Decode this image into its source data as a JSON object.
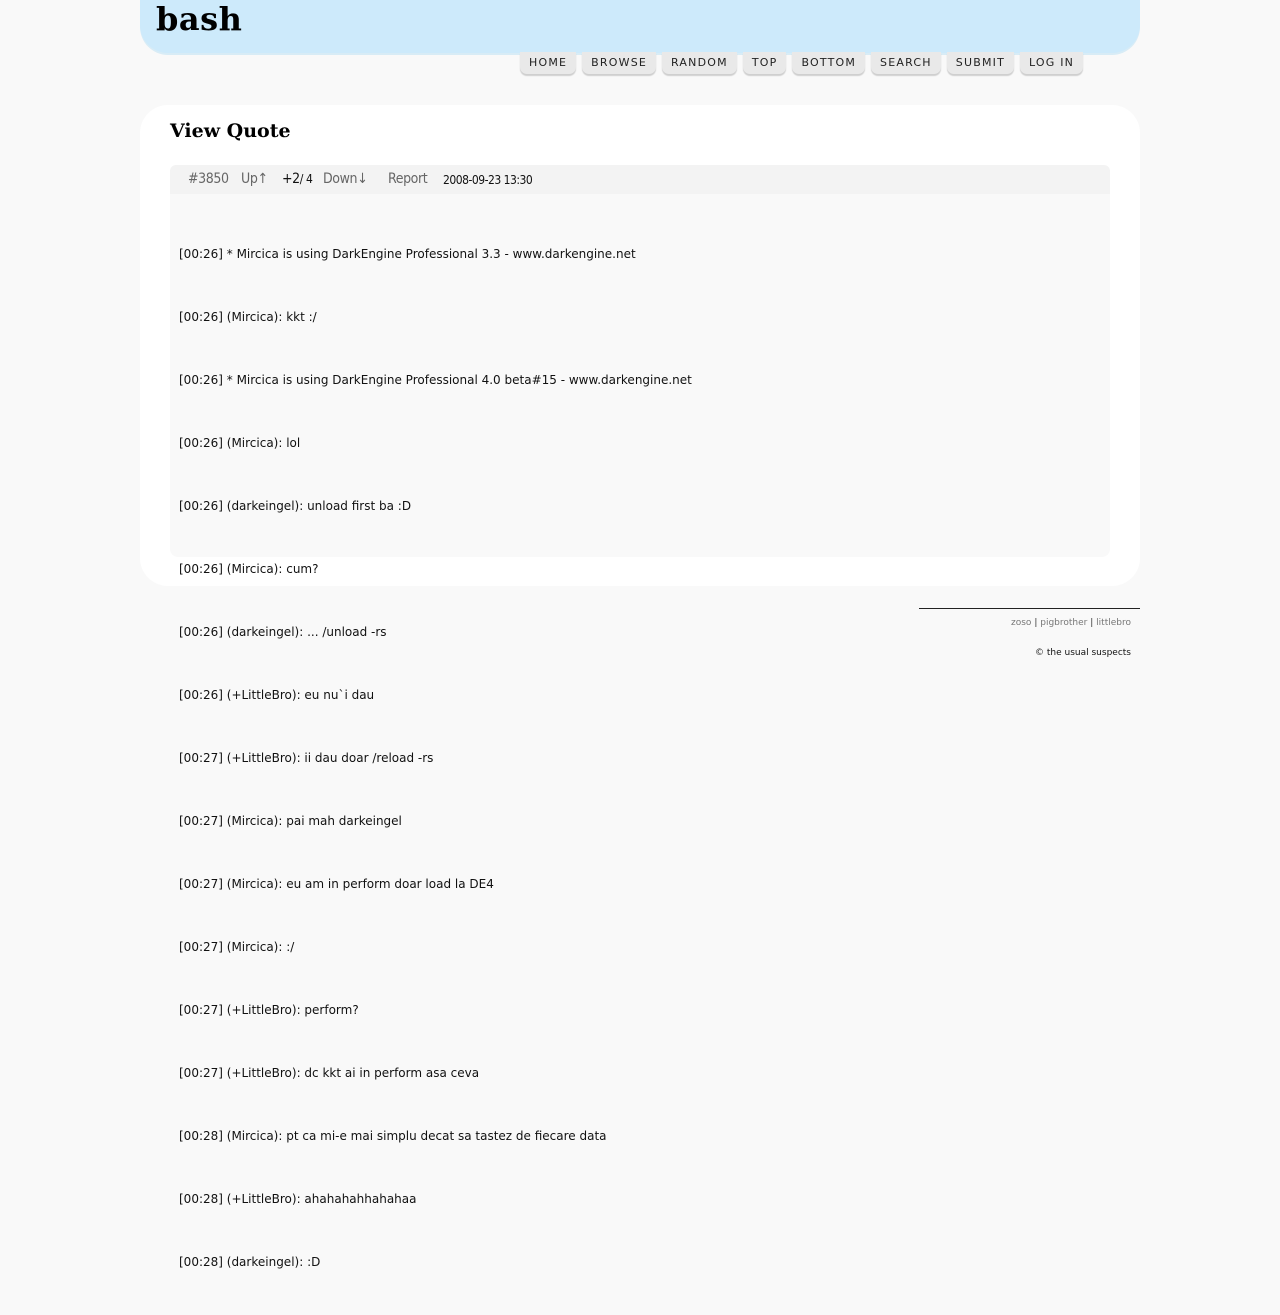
{
  "site": {
    "logo": "bash"
  },
  "nav": [
    {
      "label": "HOME"
    },
    {
      "label": "BROWSE"
    },
    {
      "label": "RANDOM"
    },
    {
      "label": "TOP"
    },
    {
      "label": "BOTTOM"
    },
    {
      "label": "SEARCH"
    },
    {
      "label": "SUBMIT"
    },
    {
      "label": "LOG IN"
    }
  ],
  "page": {
    "title": "View Quote"
  },
  "quote": {
    "id": "#3850",
    "up_label": "Up↑",
    "score": "+2",
    "score_total": "/ 4",
    "down_label": "Down↓",
    "report_label": "Report",
    "date": "2008-09-23 13:30",
    "lines": [
      "[00:26] * Mircica is using DarkEngine Professional 3.3 - www.darkengine.net",
      "[00:26] (Mircica): kkt :/",
      "[00:26] * Mircica is using DarkEngine Professional 4.0 beta#15 - www.darkengine.net",
      "[00:26] (Mircica): lol",
      "[00:26] (darkeingel): unload first ba :D",
      "[00:26] (Mircica): cum?",
      "[00:26] (darkeingel): ... /unload -rs",
      "[00:26] (+LittleBro): eu nu`i dau",
      "[00:27] (+LittleBro): ii dau doar /reload -rs",
      "[00:27] (Mircica): pai mah darkeingel",
      "[00:27] (Mircica): eu am in perform doar load la DE4",
      "[00:27] (Mircica): :/",
      "[00:27] (+LittleBro): perform?",
      "[00:27] (+LittleBro): dc kkt ai in perform asa ceva",
      "[00:28] (Mircica): pt ca mi-e mai simplu decat sa tastez de fiecare data",
      "[00:28] (+LittleBro): ahahahahhahahaa",
      "[00:28] (darkeingel): :D"
    ]
  },
  "footer": {
    "links": [
      "zoso",
      "pigbrother",
      "littlebro"
    ],
    "separator": "|",
    "copyright": "© the usual suspects"
  }
}
